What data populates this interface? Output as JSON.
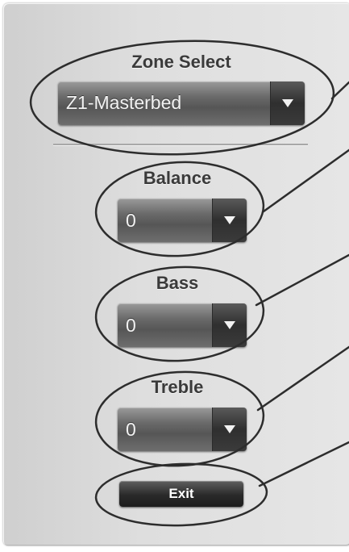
{
  "zone_select": {
    "label": "Zone Select",
    "selected": "Z1-Masterbed"
  },
  "balance": {
    "label": "Balance",
    "selected": "0"
  },
  "bass": {
    "label": "Bass",
    "selected": "0"
  },
  "treble": {
    "label": "Treble",
    "selected": "0"
  },
  "exit_button": {
    "label": "Exit"
  },
  "icons": {
    "dropdown_arrow": "chevron-down-icon"
  },
  "colors": {
    "panel": "#dcdcdc",
    "dropdown": "#6a6a6a",
    "annotation": "#2d2d2d"
  }
}
